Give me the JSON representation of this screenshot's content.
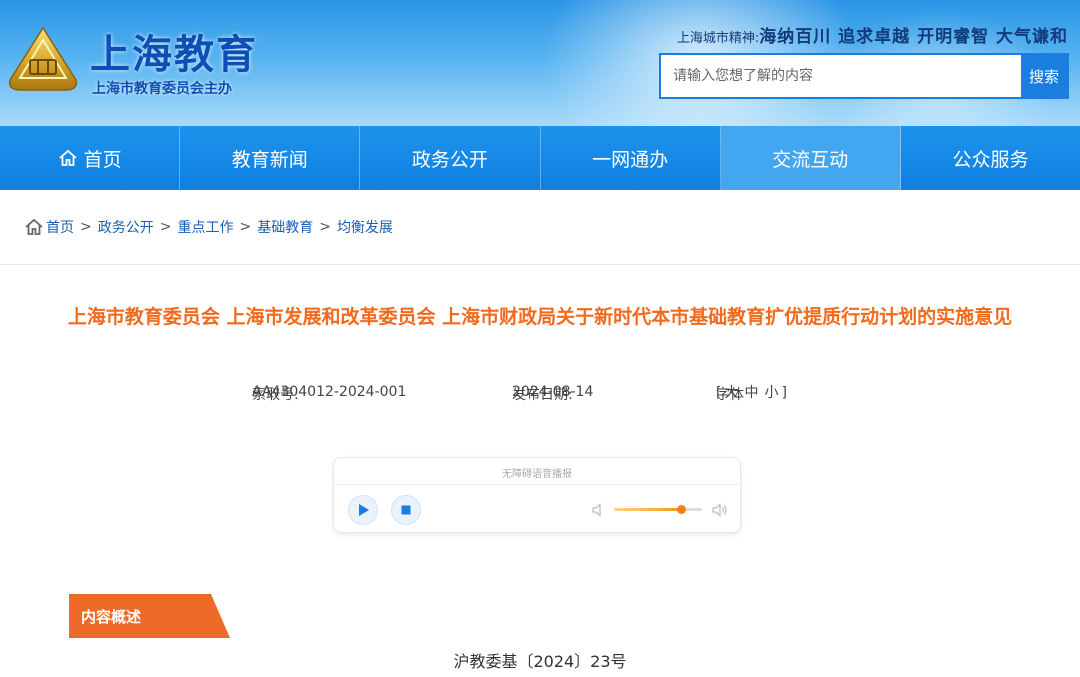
{
  "header": {
    "site_title": "上海教育",
    "site_subtitle": "上海市教育委员会主办",
    "spirit_label": "上海城市精神:",
    "spirit_slogan": "海纳百川 追求卓越 开明睿智 大气谦和",
    "emblem_icon": "shanghai-education-emblem"
  },
  "search": {
    "placeholder": "请输入您想了解的内容",
    "button_label": "搜索"
  },
  "nav": {
    "items": [
      {
        "label": "首页",
        "icon": "home-icon"
      },
      {
        "label": "教育新闻"
      },
      {
        "label": "政务公开"
      },
      {
        "label": "一网通办"
      },
      {
        "label": "交流互动",
        "active": true
      },
      {
        "label": "公众服务"
      }
    ]
  },
  "breadcrumb": [
    "首页",
    "政务公开",
    "重点工作",
    "基础教育",
    "均衡发展"
  ],
  "article": {
    "title": "上海市教育委员会 上海市发展和改革委员会 上海市财政局关于新时代本市基础教育扩优提质行动计划的实施意见",
    "index_label": "索取号:",
    "index_value": "AA4304012-2024-001",
    "date_label": "发布日期:",
    "date_value": "2024-08-14",
    "font_label": "字体",
    "font_options": [
      "大",
      "中",
      "小"
    ]
  },
  "player": {
    "title": "无障碍语音播报",
    "volume_level": 0.76
  },
  "section": {
    "label": "内容概述"
  },
  "doc_number": "沪教委基〔2024〕23号",
  "colors": {
    "nav_blue": "#1287e6",
    "title_orange": "#f26a1b",
    "tag_orange": "#ee6a28",
    "logo_blue": "#0d4fb5"
  }
}
